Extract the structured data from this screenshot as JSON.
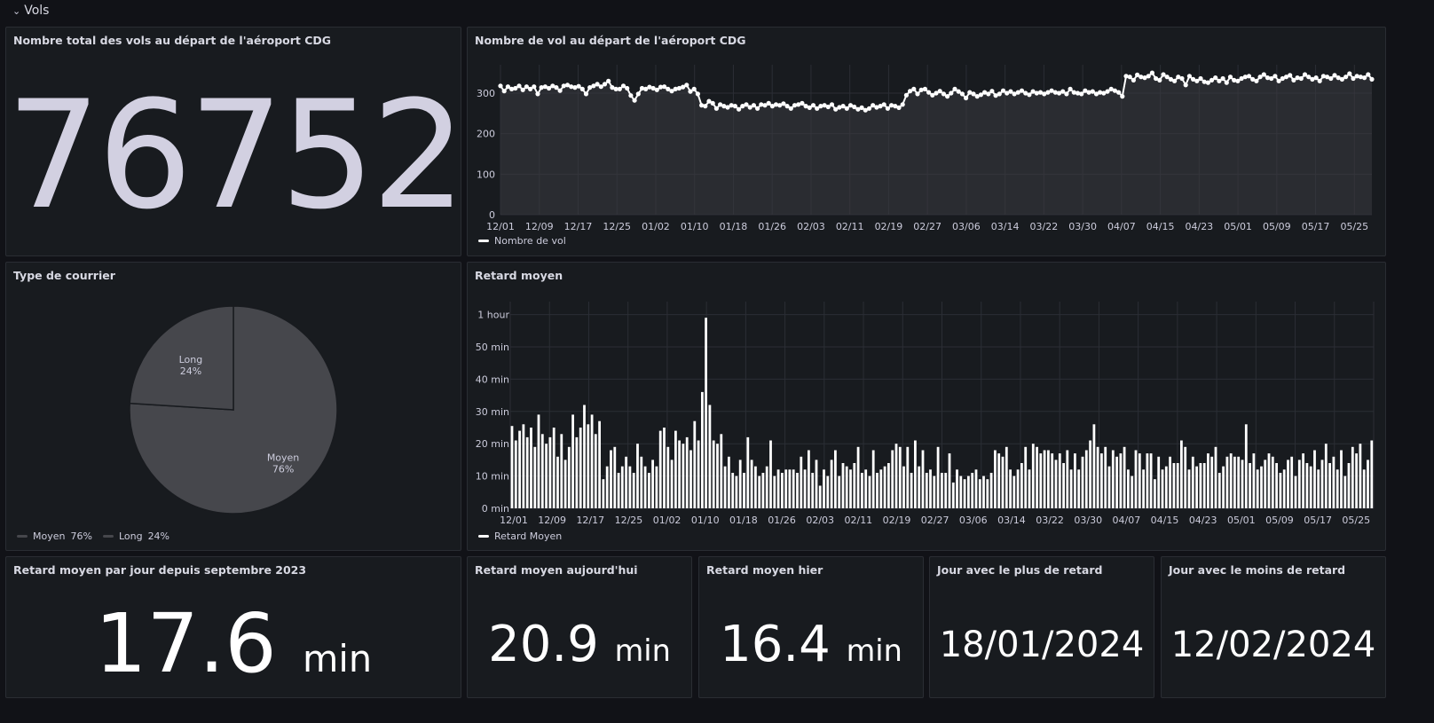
{
  "row": {
    "chevron": "⌄",
    "title": "Vols"
  },
  "panels": {
    "total": {
      "title": "Nombre total des vols au départ de l'aéroport CDG",
      "value": "76752"
    },
    "flights": {
      "title": "Nombre de vol au départ de l'aéroport CDG",
      "legend": "Nombre de vol"
    },
    "pie": {
      "title": "Type de courrier",
      "legend": [
        {
          "name": "Moyen",
          "pct": "76%"
        },
        {
          "name": "Long",
          "pct": "24%"
        }
      ]
    },
    "delay": {
      "title": "Retard moyen",
      "legend": "Retard Moyen"
    },
    "avg_day": {
      "title": "Retard moyen par jour depuis septembre 2023",
      "value": "17.6",
      "unit": "min"
    },
    "today": {
      "title": "Retard moyen aujourd'hui",
      "value": "20.9",
      "unit": "min"
    },
    "yesterday": {
      "title": "Retard moyen hier",
      "value": "16.4",
      "unit": "min"
    },
    "max_day": {
      "title": "Jour avec le plus de retard",
      "value": "18/01/2024"
    },
    "min_day": {
      "title": "Jour avec le moins de retard",
      "value": "12/02/2024"
    }
  },
  "colors": {
    "background": "#111217",
    "panel": "#181b1f",
    "series": "#ffffff",
    "big_number": "#d2d0e1",
    "pie_slice": "#46474c"
  },
  "chart_data": [
    {
      "type": "line",
      "title": "Nombre de vol au départ de l'aéroport CDG",
      "x_ticks": [
        "12/01",
        "12/09",
        "12/17",
        "12/25",
        "01/02",
        "01/10",
        "01/18",
        "01/26",
        "02/03",
        "02/11",
        "02/19",
        "02/27",
        "03/06",
        "03/14",
        "03/22",
        "03/30",
        "04/07",
        "04/15",
        "04/23",
        "05/01",
        "05/09",
        "05/17",
        "05/25"
      ],
      "y_ticks": [
        "0",
        "100",
        "200",
        "300"
      ],
      "ylim": [
        0,
        370
      ],
      "series": [
        {
          "name": "Nombre de vol",
          "start": "12/01",
          "end": "05/31",
          "values": [
            318,
            305,
            316,
            310,
            312,
            318,
            308,
            316,
            310,
            316,
            298,
            314,
            316,
            312,
            318,
            314,
            306,
            318,
            320,
            316,
            314,
            317,
            310,
            298,
            314,
            318,
            322,
            316,
            322,
            330,
            314,
            310,
            310,
            318,
            312,
            294,
            282,
            298,
            312,
            310,
            315,
            312,
            308,
            315,
            316,
            310,
            305,
            310,
            312,
            315,
            320,
            304,
            310,
            298,
            270,
            268,
            280,
            275,
            262,
            272,
            268,
            265,
            270,
            268,
            260,
            268,
            272,
            265,
            270,
            262,
            272,
            270,
            275,
            268,
            272,
            270,
            274,
            268,
            262,
            270,
            272,
            275,
            268,
            264,
            270,
            262,
            268,
            270,
            266,
            272,
            260,
            265,
            268,
            262,
            270,
            266,
            260,
            264,
            258,
            262,
            270,
            265,
            268,
            272,
            262,
            270,
            268,
            264,
            272,
            295,
            305,
            310,
            298,
            308,
            310,
            302,
            295,
            300,
            305,
            298,
            292,
            300,
            310,
            304,
            298,
            288,
            302,
            298,
            292,
            296,
            302,
            298,
            305,
            294,
            298,
            306,
            300,
            304,
            298,
            302,
            306,
            300,
            296,
            304,
            300,
            302,
            298,
            302,
            306,
            302,
            300,
            304,
            298,
            310,
            302,
            300,
            298,
            306,
            302,
            304,
            298,
            302,
            300,
            304,
            310,
            306,
            302,
            292,
            342,
            340,
            332,
            345,
            340,
            338,
            342,
            350,
            336,
            332,
            346,
            340,
            334,
            330,
            340,
            336,
            320,
            342,
            334,
            330,
            336,
            328,
            326,
            332,
            338,
            330,
            336,
            326,
            340,
            332,
            330,
            336,
            340,
            342,
            334,
            330,
            340,
            346,
            338,
            336,
            342,
            330,
            336,
            340,
            344,
            332,
            338,
            336,
            346,
            340,
            334,
            338,
            330,
            342,
            340,
            336,
            344,
            338,
            334,
            340,
            348,
            336,
            342,
            340,
            338,
            346,
            334
          ]
        }
      ]
    },
    {
      "type": "pie",
      "title": "Type de courrier",
      "series": [
        {
          "name": "Moyen",
          "value": 76
        },
        {
          "name": "Long",
          "value": 24
        }
      ]
    },
    {
      "type": "bar",
      "title": "Retard moyen",
      "x_ticks": [
        "12/01",
        "12/09",
        "12/17",
        "12/25",
        "01/02",
        "01/10",
        "01/18",
        "01/26",
        "02/03",
        "02/11",
        "02/19",
        "02/27",
        "03/06",
        "03/14",
        "03/22",
        "03/30",
        "04/07",
        "04/15",
        "04/23",
        "05/01",
        "05/09",
        "05/17",
        "05/25"
      ],
      "y_ticks": [
        "0 min",
        "10 min",
        "20 min",
        "30 min",
        "40 min",
        "50 min",
        "1 hour"
      ],
      "ylim": [
        0,
        64
      ],
      "series": [
        {
          "name": "Retard Moyen",
          "unit": "min",
          "start": "12/01",
          "end": "05/31",
          "values": [
            25.5,
            21,
            24,
            26,
            22,
            25,
            19,
            29,
            23,
            20,
            22,
            25,
            16,
            23,
            15,
            19,
            29,
            22,
            25,
            32,
            26,
            29,
            23,
            27,
            9,
            13,
            18,
            19,
            11,
            13,
            16,
            13,
            11,
            20,
            16,
            13,
            11,
            15,
            13,
            24,
            25,
            19,
            15,
            24,
            21,
            20,
            22,
            18,
            27,
            21,
            36,
            59,
            32,
            21,
            20,
            23,
            13,
            16,
            11,
            10,
            15,
            11,
            22,
            15,
            13,
            10,
            11,
            13,
            21,
            10,
            12,
            11,
            12,
            12,
            12,
            11,
            16,
            12,
            18,
            11,
            15,
            7,
            12,
            10,
            15,
            18,
            10,
            14,
            13,
            12,
            14,
            19,
            11,
            12,
            10,
            18,
            11,
            12,
            13,
            14,
            18,
            20,
            19,
            13,
            19,
            11,
            21,
            13,
            18,
            11,
            12,
            10,
            19,
            11,
            11,
            17,
            8,
            12,
            10,
            9,
            10,
            11,
            12,
            9,
            10,
            9,
            11,
            18,
            17,
            16,
            19,
            12,
            10,
            12,
            14,
            19,
            12,
            20,
            19,
            17,
            18,
            18,
            17,
            15,
            17,
            14,
            18,
            12,
            17,
            12,
            16,
            18,
            21,
            26,
            19,
            17,
            19,
            13,
            18,
            16,
            17,
            19,
            12,
            10,
            18,
            17,
            12,
            17,
            17,
            9,
            16,
            12,
            13,
            16,
            14,
            14,
            21,
            19,
            12,
            16,
            13,
            14,
            14,
            17,
            16,
            19,
            11,
            13,
            16,
            17,
            16,
            16,
            15,
            26,
            14,
            17,
            12,
            13,
            15,
            17,
            16,
            14,
            11,
            12,
            15,
            16,
            10,
            15,
            17,
            14,
            13,
            18,
            12,
            15,
            20,
            14,
            16,
            12,
            18,
            10,
            14,
            19,
            17,
            20,
            12,
            15,
            21
          ]
        }
      ]
    }
  ]
}
